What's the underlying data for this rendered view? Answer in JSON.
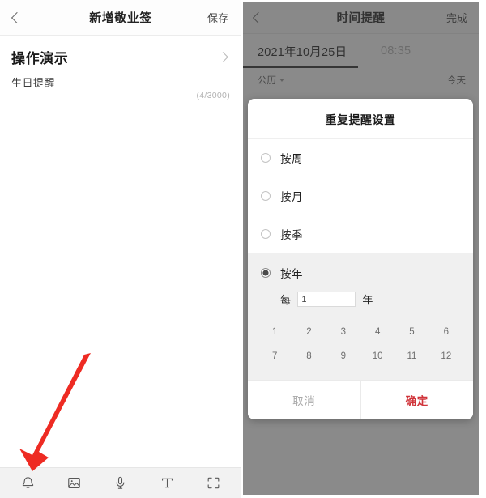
{
  "left_screen": {
    "header": {
      "back_icon": "chevron-left-icon",
      "title": "新增敬业签",
      "save_label": "保存"
    },
    "note": {
      "title": "操作演示",
      "subtitle": "生日提醒",
      "counter": "(4/3000)",
      "expand_icon": "chevron-right-icon"
    },
    "toolbar": [
      {
        "name": "bell-icon",
        "label": "提醒"
      },
      {
        "name": "image-icon",
        "label": "图片"
      },
      {
        "name": "microphone-icon",
        "label": "语音"
      },
      {
        "name": "text-icon",
        "label": "文字"
      },
      {
        "name": "fullscreen-icon",
        "label": "全屏"
      }
    ],
    "annotation": {
      "type": "red-arrow",
      "color": "#ee2b23",
      "points_to": "bell-icon"
    }
  },
  "right_screen": {
    "header": {
      "back_icon": "chevron-left-icon",
      "title": "时间提醒",
      "done_label": "完成"
    },
    "datetime": {
      "date_value": "2021年10月25日",
      "time_value": "08:35",
      "active_tab": "date"
    },
    "calendar_row": {
      "calendar_type": "公历",
      "dropdown_icon": "caret-down-icon",
      "today_label": "今天"
    },
    "dialog": {
      "title": "重复提醒设置",
      "options": [
        {
          "label": "按周",
          "selected": false
        },
        {
          "label": "按月",
          "selected": false
        },
        {
          "label": "按季",
          "selected": false
        },
        {
          "label": "按年",
          "selected": true
        }
      ],
      "interval": {
        "prefix": "每",
        "value": "1",
        "placeholder": "1",
        "suffix": "年"
      },
      "numbers": [
        "1",
        "2",
        "3",
        "4",
        "5",
        "6",
        "7",
        "8",
        "9",
        "10",
        "11",
        "12"
      ],
      "cancel_label": "取消",
      "confirm_label": "确定",
      "confirm_color": "#d0343a"
    }
  }
}
